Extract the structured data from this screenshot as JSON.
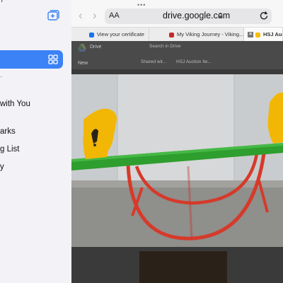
{
  "sidebar": {
    "top_partial": "7",
    "items": [
      {
        "label": "with You"
      },
      {
        "label": "arks"
      },
      {
        "label": "g List"
      },
      {
        "label": "y"
      }
    ]
  },
  "browser": {
    "text_size_label": "AA",
    "url": "drive.google.com",
    "tabs": [
      {
        "label": "View your certificate",
        "icon_color": "#1a73e8"
      },
      {
        "label": "My Viking Journey - Viking...",
        "icon_color": "#c62828"
      },
      {
        "label": "HSJ Auctio",
        "icon_color": "#fbbc04",
        "active": true
      }
    ]
  },
  "drive": {
    "app_name": "Drive",
    "search_placeholder": "Search in Drive",
    "new_label": "New",
    "breadcrumb_shared": "Shared wit...",
    "breadcrumb_folder": "HSJ Auction Ite...",
    "photo_subject": "yellow horse-head teeter-totter with green board on red tubular base"
  },
  "colors": {
    "accent": "#3b82f6",
    "board_green": "#2e9e2e",
    "frame_red": "#d63a2a",
    "seat_yellow": "#f2b705"
  }
}
